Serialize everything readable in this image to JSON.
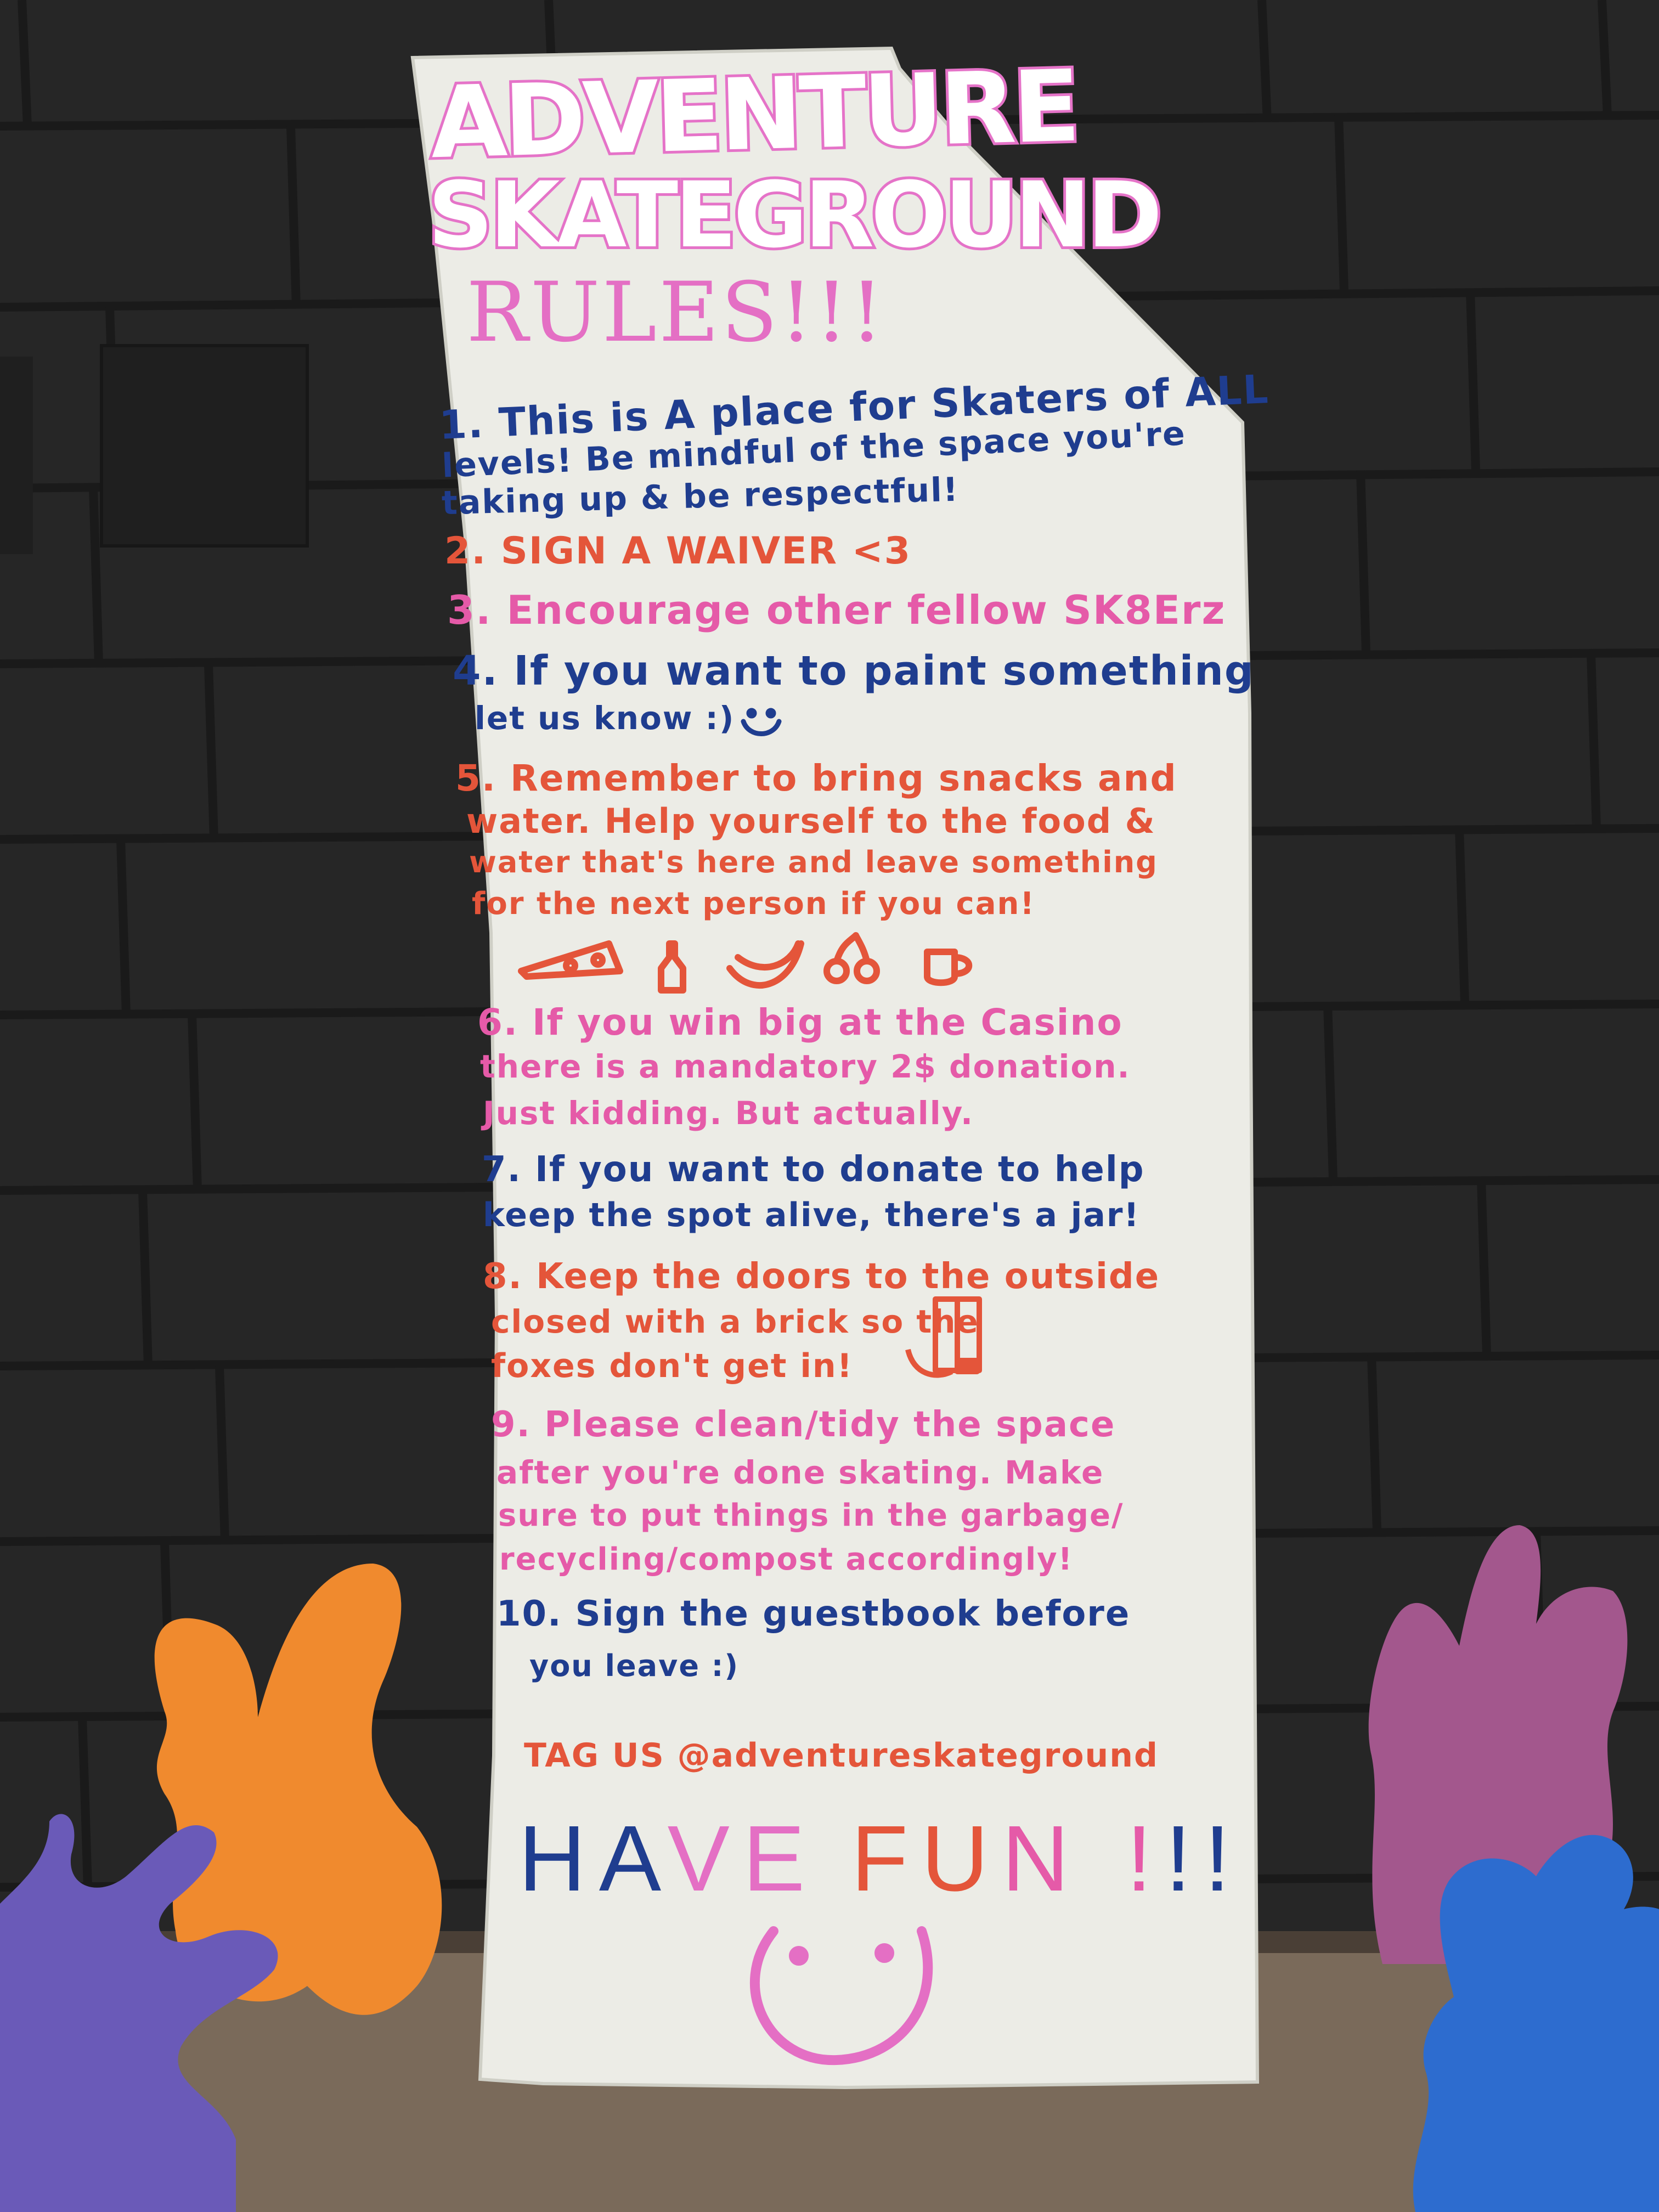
{
  "colors": {
    "wall": "#262626",
    "board": "#ecece6",
    "pink": "#e46fc4",
    "blue": "#1f3d8f",
    "orange": "#e4553a",
    "magenta": "#e55aa8",
    "cutout_orange": "#f08a2e",
    "cutout_purple": "#6a5ab8",
    "cutout_mauve": "#a3578d",
    "cutout_blue": "#2d6ccf"
  },
  "sign": {
    "title_line1": "ADVENTURE",
    "title_line2": "SKATEGROUND",
    "heading": "RULES!!!",
    "rules": [
      {
        "lines": [
          "1. This is A place for Skaters of ALL",
          "levels! Be mindful of the space you're",
          "taking up & be respectful!"
        ],
        "color": "blue"
      },
      {
        "lines": [
          "2. SIGN A WAIVER <3"
        ],
        "color": "orange"
      },
      {
        "lines": [
          "3. Encourage other fellow SK8Erz"
        ],
        "color": "magenta"
      },
      {
        "lines": [
          "4. If you want to paint something",
          "let us know :)"
        ],
        "color": "blue"
      },
      {
        "lines": [
          "5. Remember to bring snacks and",
          "water. Help yourself to the food &",
          "water that's here and leave something",
          "for the next person if you can!"
        ],
        "color": "orange"
      },
      {
        "lines": [
          "6. If you win big at the Casino",
          "there is a mandatory 2$ donation.",
          "Just kidding. But actually."
        ],
        "color": "magenta"
      },
      {
        "lines": [
          "7. If you want to donate to help",
          "keep the spot alive, there's a jar!"
        ],
        "color": "blue"
      },
      {
        "lines": [
          "8. Keep the doors to the outside",
          "closed with a brick     so the",
          "foxes don't get in!"
        ],
        "color": "orange"
      },
      {
        "lines": [
          "9. Please clean/tidy the space",
          "after you're done skating. Make",
          "sure to put things in the garbage/",
          "recycling/compost accordingly!"
        ],
        "color": "magenta"
      },
      {
        "lines": [
          "10. Sign the guestbook before",
          "you leave :)"
        ],
        "color": "blue"
      }
    ],
    "tag": "TAG US @adventureskateground",
    "fun_letters": [
      {
        "ch": "H",
        "color": "blue"
      },
      {
        "ch": "A",
        "color": "blue"
      },
      {
        "ch": "V",
        "color": "pink"
      },
      {
        "ch": "E",
        "color": "pink"
      },
      {
        "ch": "F",
        "color": "orange"
      },
      {
        "ch": "U",
        "color": "orange"
      },
      {
        "ch": "N",
        "color": "magenta"
      },
      {
        "ch": "!",
        "color": "magenta"
      },
      {
        "ch": "!",
        "color": "blue"
      },
      {
        "ch": "!",
        "color": "blue"
      }
    ],
    "snack_icons": [
      "pizza-icon",
      "bottle-icon",
      "banana-icon",
      "cherries-icon",
      "mug-icon"
    ]
  }
}
